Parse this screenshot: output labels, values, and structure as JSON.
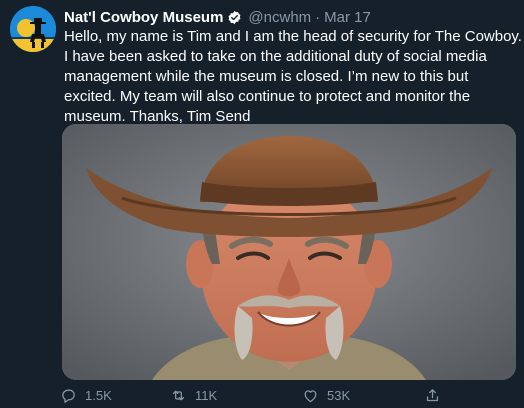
{
  "tweet": {
    "display_name": "Nat'l Cowboy Museum",
    "handle": "@ncwhm",
    "separator": "·",
    "date": "Mar 17",
    "text": "Hello, my name is Tim and I am the head of security for The Cowboy. I have been asked to take on the additional duty of social media management while the museum is closed. I’m new to this but excited. My team will also continue to protect and monitor the museum. Thanks, Tim Send",
    "verified": true
  },
  "actions": {
    "reply_count": "1.5K",
    "retweet_count": "11K",
    "like_count": "53K"
  },
  "icons": {
    "avatar": "cowboy-silhouette-icon",
    "verified": "verified-badge-icon",
    "reply": "reply-icon",
    "retweet": "retweet-icon",
    "like": "heart-icon",
    "share": "share-icon"
  },
  "colors": {
    "background": "#15202b",
    "secondary_text": "#8899a6",
    "avatar_blue": "#1b8ad8",
    "avatar_yellow": "#f2c230"
  }
}
